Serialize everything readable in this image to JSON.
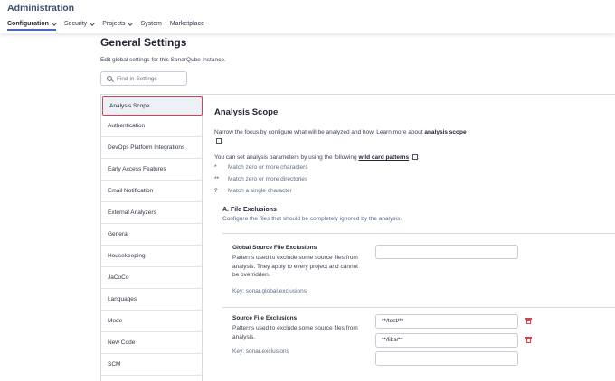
{
  "header": {
    "title": "Administration",
    "nav": [
      {
        "label": "Configuration",
        "dropdown": true
      },
      {
        "label": "Security",
        "dropdown": true
      },
      {
        "label": "Projects",
        "dropdown": true
      },
      {
        "label": "System",
        "dropdown": false
      },
      {
        "label": "Marketplace",
        "dropdown": false
      }
    ]
  },
  "page": {
    "title": "General Settings",
    "description": "Edit global settings for this SonarQube instance.",
    "search_placeholder": "Find in Settings"
  },
  "sidebar": {
    "items": [
      "Analysis Scope",
      "Authentication",
      "DevOps Platform Integrations",
      "Early Access Features",
      "Email Notification",
      "External Analyzers",
      "General",
      "Housekeeping",
      "JaCoCo",
      "Languages",
      "Mode",
      "New Code",
      "SCM"
    ]
  },
  "main": {
    "title": "Analysis Scope",
    "intro_text": "Narrow the focus by configure what will be analyzed and how. Learn more about",
    "intro_link": "analysis scope",
    "params_text": "You can set analysis parameters by using the following",
    "params_link": "wild card patterns",
    "params_suffix": ":",
    "wildcards": [
      {
        "symbol": "*",
        "desc": "Match zero or more characters"
      },
      {
        "symbol": "**",
        "desc": "Match zero or more directories"
      },
      {
        "symbol": "?",
        "desc": "Match a single character"
      }
    ],
    "file_exclusions": {
      "title": "A. File Exclusions",
      "desc": "Configure the files that should be completely ignored by the analysis."
    },
    "global_exclusions": {
      "title": "Global Source File Exclusions",
      "desc": "Patterns used to exclude some source files from analysis. They apply to every project and cannot be overridden.",
      "key": "Key: sonar.global.exclusions",
      "value": ""
    },
    "source_exclusions": {
      "title": "Source File Exclusions",
      "desc": "Patterns used to exclude some source files from analysis.",
      "key": "Key: sonar.exclusions",
      "values": [
        "**/test/**",
        "**/libs/**",
        ""
      ]
    }
  },
  "colors": {
    "accent": "#4b66c5",
    "active_outline": "#d8404f",
    "delete": "#d8404f"
  }
}
